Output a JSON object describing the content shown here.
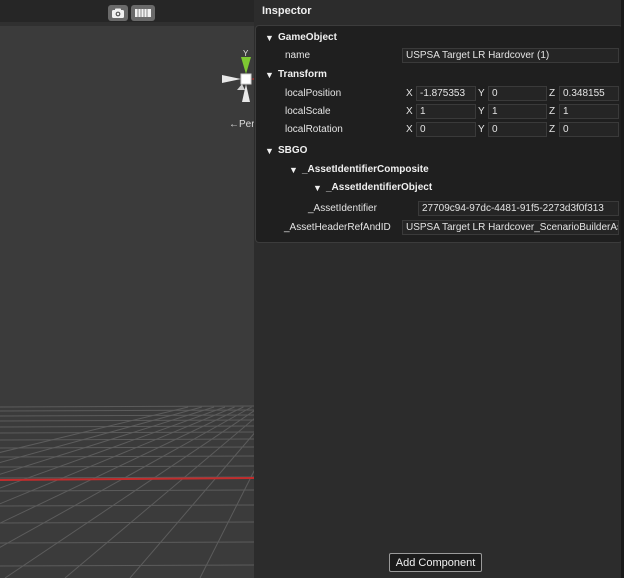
{
  "scene": {
    "persp_label": "←Persp",
    "gizmo_axes": {
      "y": "Y",
      "x": "X"
    },
    "icons": [
      "camera-icon",
      "grid-icon"
    ],
    "colors": {
      "red_axis": "#c22c2c",
      "green_axis": "#7ec832",
      "grid_line": "#5a5a5a"
    }
  },
  "inspector": {
    "title": "Inspector",
    "add_component_label": "Add Component",
    "gameobject": {
      "header": "GameObject",
      "name_label": "name",
      "name_value": "USPSA Target LR Hardcover (1)"
    },
    "transform": {
      "header": "Transform",
      "rows": [
        {
          "label": "localPosition",
          "x": "-1.875353",
          "y": "0",
          "z": "0.348155"
        },
        {
          "label": "localScale",
          "x": "1",
          "y": "1",
          "z": "1"
        },
        {
          "label": "localRotation",
          "x": "0",
          "y": "0",
          "z": "0"
        }
      ]
    },
    "sbgo": {
      "header": "SBGO",
      "composite_header": "_AssetIdentifierComposite",
      "object_header": "_AssetIdentifierObject",
      "asset_identifier_label": "_AssetIdentifier",
      "asset_identifier_value": "27709c94-97dc-4481-91f5-2273d3f0f313",
      "header_ref_label": "_AssetHeaderRefAndID",
      "header_ref_value": "USPSA Target LR Hardcover_ScenarioBuilderAs"
    },
    "axis_letters": {
      "x": "X",
      "y": "Y",
      "z": "Z"
    }
  }
}
